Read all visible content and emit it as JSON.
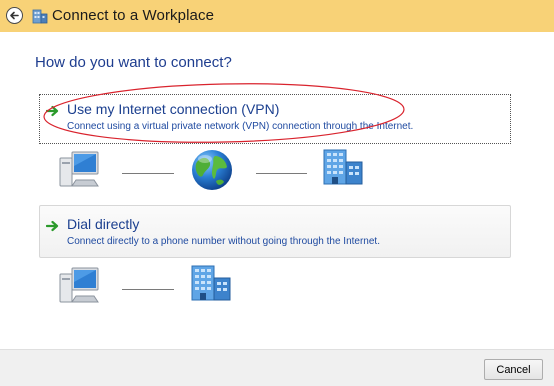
{
  "window": {
    "title": "Connect to a Workplace",
    "title_bar_color": "#f8d277"
  },
  "main": {
    "heading": "How do you want to connect?",
    "options": [
      {
        "label": "Use my Internet connection (VPN)",
        "description": "Connect using a virtual private network (VPN) connection through the Internet."
      },
      {
        "label": "Dial directly",
        "description": "Connect directly to a phone number without going through the Internet."
      }
    ]
  },
  "footer": {
    "cancel_label": "Cancel"
  },
  "icons": {
    "back": "back-arrow-icon",
    "title": "workplace-network-icon",
    "option_arrow": "green-arrow-icon",
    "computer": "computer-icon",
    "internet": "globe-icon",
    "workplace": "office-building-icon"
  },
  "colors": {
    "heading": "#1e3d8f",
    "option_text": "#1b3f8f",
    "highlight_ellipse": "#d9232d"
  }
}
